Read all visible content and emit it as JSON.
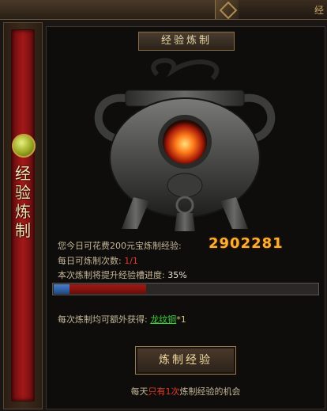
{
  "top": {
    "tab_label": "经"
  },
  "side": {
    "title": "经\n验\n炼\n制"
  },
  "panel": {
    "title": "经验炼制",
    "spend_label": "您今日可花费200元宝炼制经验:",
    "exp_value": "2902281",
    "daily_label": "每日可炼制次数:",
    "daily_value": "1/1",
    "progress_label": "本次炼制将提升经验槽进度:",
    "progress_value": "35%",
    "progress_fraction": 0.35,
    "reward_label": "每次炼制均可额外获得:",
    "reward_item": "龙纹铜",
    "reward_mult": "*1",
    "button_label": "炼制经验",
    "chance_pre": "每天",
    "chance_red": "只有1次",
    "chance_post": "炼制经验的机会"
  },
  "colors": {
    "exp_value": "#ffae2e",
    "highlight_red": "#e23b2b",
    "reward_green": "#3ad23a",
    "progress_fill": "#a11a14"
  }
}
